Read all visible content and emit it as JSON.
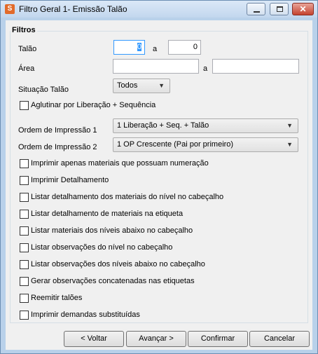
{
  "window": {
    "title": "Filtro Geral 1- Emissão Talão",
    "app_icon_glyph": "S"
  },
  "group": {
    "title": "Filtros"
  },
  "talao": {
    "label": "Talão",
    "from_value": "0",
    "sep": "a",
    "to_value": "0"
  },
  "area": {
    "label": "Área",
    "from_value": "",
    "sep": "a",
    "to_value": ""
  },
  "situacao": {
    "label": "Situação Talão",
    "selected": "Todos"
  },
  "aglutinar": {
    "label": "Aglutinar por Liberação + Sequência",
    "checked": false
  },
  "ordem1": {
    "label": "Ordem de Impressão 1",
    "selected": "1 Liberação + Seq. + Talão"
  },
  "ordem2": {
    "label": "Ordem de Impressão 2",
    "selected": "1 OP Crescente (Pai por primeiro)"
  },
  "checkboxes": [
    {
      "label": "Imprimir apenas materiais que possuam numeração",
      "checked": false
    },
    {
      "label": "Imprimir Detalhamento",
      "checked": false
    },
    {
      "label": "Listar detalhamento dos materiais do nível no cabeçalho",
      "checked": false
    },
    {
      "label": "Listar detalhamento de materiais na etiqueta",
      "checked": false
    },
    {
      "label": "Listar materiais dos níveis abaixo no cabeçalho",
      "checked": false
    },
    {
      "label": "Listar observações do nível no cabeçalho",
      "checked": false
    },
    {
      "label": "Listar observações dos níveis abaixo no cabeçalho",
      "checked": false
    },
    {
      "label": "Gerar observações concatenadas nas etiquetas",
      "checked": false
    },
    {
      "label": "Reemitir talões",
      "checked": false
    },
    {
      "label": "Imprimir demandas substituídas",
      "checked": false
    }
  ],
  "buttons": {
    "back": "< Voltar",
    "next": "Avançar >",
    "confirm": "Confirmar",
    "cancel": "Cancelar"
  },
  "icons": {
    "minimize": "minimize-icon",
    "maximize": "maximize-icon",
    "close": "close-icon",
    "dropdown": "chevron-down-icon"
  },
  "colors": {
    "title_bar": "#c2d7ee",
    "close_button": "#c4432f",
    "focus": "#3399ff"
  }
}
